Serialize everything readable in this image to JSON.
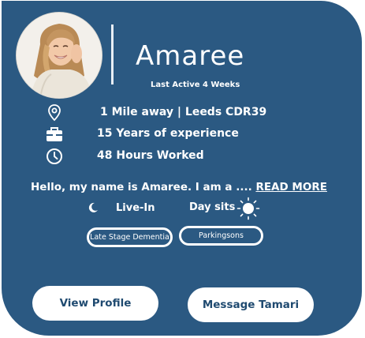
{
  "profile": {
    "name": "Amaree",
    "last_active": "Last Active 4 Weeks"
  },
  "info": [
    {
      "icon": "location-pin-icon",
      "text": "1 Mile away | Leeds CDR39"
    },
    {
      "icon": "briefcase-icon",
      "text": "15 Years of experience"
    },
    {
      "icon": "clock-icon",
      "text": "48 Hours Worked"
    }
  ],
  "bio": {
    "text": "Hello, my name is Amaree. I am a .... ",
    "read_more": "READ MORE"
  },
  "availability": {
    "live_in": {
      "icon": "moon-icon",
      "label": "Live-In"
    },
    "day_sits": {
      "icon": "sun-icon",
      "label": "Day sits"
    }
  },
  "specialisms": [
    "Late Stage Dementia",
    "Parkingsons"
  ],
  "actions": {
    "view_profile": "View Profile",
    "message": "Message Tamari"
  },
  "colors": {
    "card": "#2b5982",
    "text": "#ffffff",
    "button_text": "#1f4a70"
  }
}
